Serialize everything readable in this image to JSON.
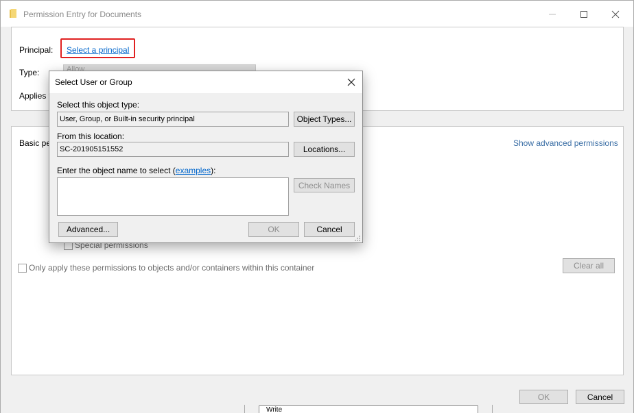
{
  "window": {
    "title": "Permission Entry for Documents",
    "folder_icon": "folder-icon",
    "minimize_icon": "minimize-icon",
    "maximize_icon": "maximize-icon",
    "close_icon": "close-icon"
  },
  "principal": {
    "label": "Principal:",
    "link": "Select a principal",
    "highlight_color": "#e02020"
  },
  "type": {
    "label": "Type:",
    "value": "Allow"
  },
  "applies_to": {
    "label": "Applies t"
  },
  "permissions": {
    "basic_label": "Basic pe",
    "show_advanced": "Show advanced permissions",
    "special_permissions": "Special permissions",
    "only_apply": "Only apply these permissions to objects and/or containers within this container",
    "clear_all": "Clear all"
  },
  "footer": {
    "ok": "OK",
    "cancel": "Cancel",
    "behind_select_value": "Write"
  },
  "dialog": {
    "title": "Select User or Group",
    "object_type_label": "Select this object type:",
    "object_type_value": "User, Group, or Built-in security principal",
    "object_types_button": "Object Types...",
    "location_label": "From this location:",
    "location_value": "SC-201905151552",
    "locations_button": "Locations...",
    "enter_name_prefix": "Enter the object name to select (",
    "examples_link": "examples",
    "enter_name_suffix": "):",
    "check_names_button": "Check Names",
    "advanced_button": "Advanced...",
    "ok_button": "OK",
    "cancel_button": "Cancel"
  }
}
